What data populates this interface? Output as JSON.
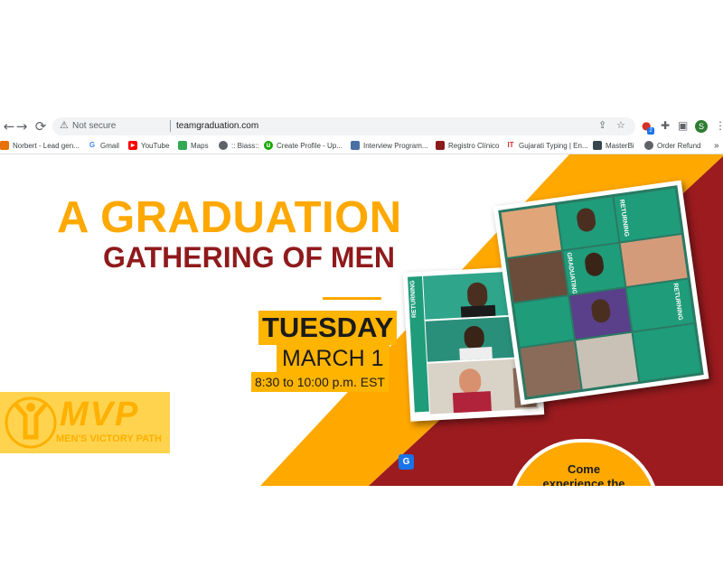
{
  "browser": {
    "nav": {
      "back": "←",
      "forward": "→",
      "reload": "⟳"
    },
    "address_bar": {
      "security_label": "Not secure",
      "url": "teamgraduation.com"
    },
    "toolbar_icons": [
      "share-icon",
      "star-icon",
      "extension-icon",
      "puzzle-icon",
      "side-panel-icon",
      "profile-avatar",
      "menu-icon"
    ],
    "profile_initial": "S",
    "extension_badge": "2",
    "bookmarks": [
      {
        "label": "Norbert - Lead gen...",
        "icon": "norbert-icon",
        "color": "#e8710a"
      },
      {
        "label": "Gmail",
        "icon": "google-icon",
        "color": "#4285f4"
      },
      {
        "label": "YouTube",
        "icon": "youtube-icon",
        "color": "#ff0000"
      },
      {
        "label": "Maps",
        "icon": "maps-icon",
        "color": "#34a853"
      },
      {
        "label": ":: Biass::",
        "icon": "globe-icon",
        "color": "#5f6368"
      },
      {
        "label": "Create Profile - Up...",
        "icon": "upwork-icon",
        "color": "#14a800"
      },
      {
        "label": "Interview Program...",
        "icon": "doc-icon",
        "color": "#4a6fa5"
      },
      {
        "label": "Registro Clínico",
        "icon": "registro-icon",
        "color": "#8b1a1a"
      },
      {
        "label": "Gujarati Typing | En...",
        "icon": "typing-icon",
        "color": "#d32f2f"
      },
      {
        "label": "MasterBi",
        "icon": "masterbi-icon",
        "color": "#37474f"
      },
      {
        "label": "Order Refund",
        "icon": "globe-icon",
        "color": "#5f6368"
      }
    ],
    "more_bookmarks": "»"
  },
  "page": {
    "headline_1": "A GRADUATION",
    "headline_2": "GATHERING OF MEN",
    "day": "TUESDAY",
    "date": "MARCH 1",
    "time": "8:30 to 10:00 p.m. EST",
    "logo_text": "MVP",
    "logo_subtext": "MEN'S VICTORY PATH",
    "cta_line_1": "Come",
    "cta_line_2": "experience the",
    "translate_icon": "translate-icon",
    "photo_labels": [
      "RETURNING",
      "RETURNING",
      "GRADUATING",
      "RETURNING"
    ]
  },
  "colors": {
    "gold": "#ffa800",
    "maroon": "#9b1b1f",
    "highlight": "#ffb400",
    "headline_gold": "#ffa800",
    "headline_maroon": "#8f1a1c",
    "meeting_green": "#1f9c7a"
  }
}
